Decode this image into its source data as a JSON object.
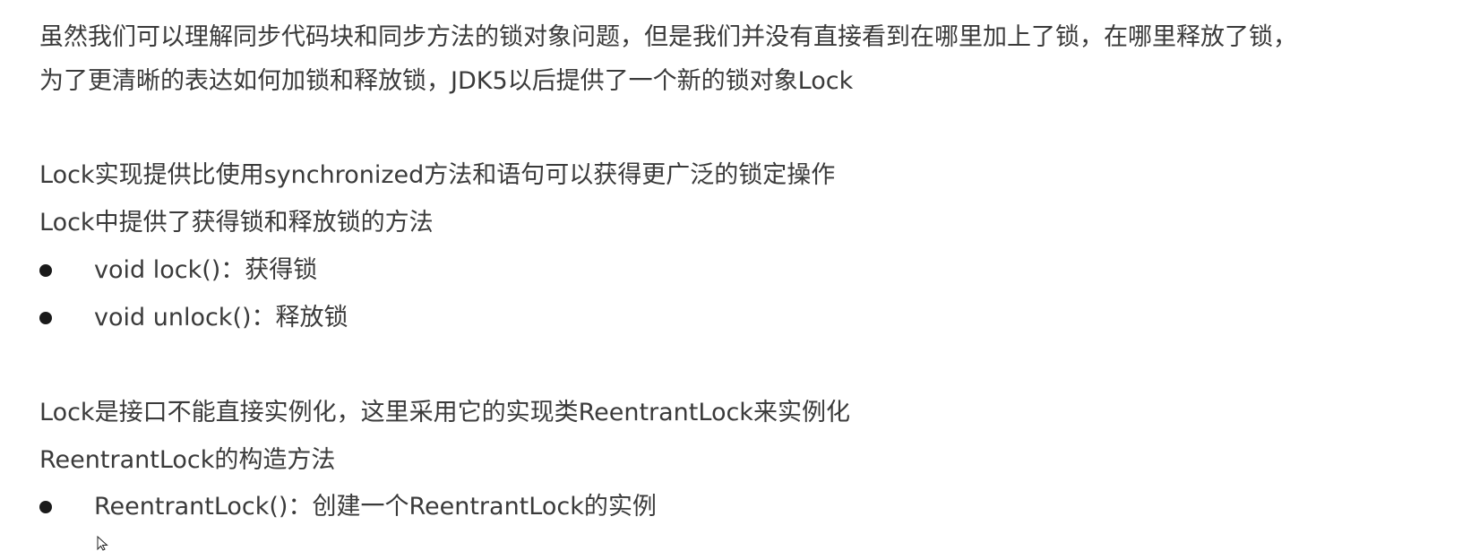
{
  "paragraphs": {
    "intro_line1": "虽然我们可以理解同步代码块和同步方法的锁对象问题，但是我们并没有直接看到在哪里加上了锁，在哪里释放了锁，",
    "intro_line2": "为了更清晰的表达如何加锁和释放锁，JDK5以后提供了一个新的锁对象Lock",
    "lock_desc": "Lock实现提供比使用synchronized方法和语句可以获得更广泛的锁定操作",
    "lock_methods_heading": "Lock中提供了获得锁和释放锁的方法",
    "lock_interface_note": "Lock是接口不能直接实例化，这里采用它的实现类ReentrantLock来实例化",
    "constructor_heading": "ReentrantLock的构造方法"
  },
  "lock_methods": [
    "void lock()：获得锁",
    "void unlock()：释放锁"
  ],
  "constructors": [
    "ReentrantLock()：创建一个ReentrantLock的实例"
  ],
  "icons": {
    "bullet": "bullet-dot-icon",
    "cursor": "mouse-pointer-icon"
  },
  "colors": {
    "text": "#3a3a3a",
    "bullet": "#1a1a1a",
    "background": "#ffffff"
  }
}
